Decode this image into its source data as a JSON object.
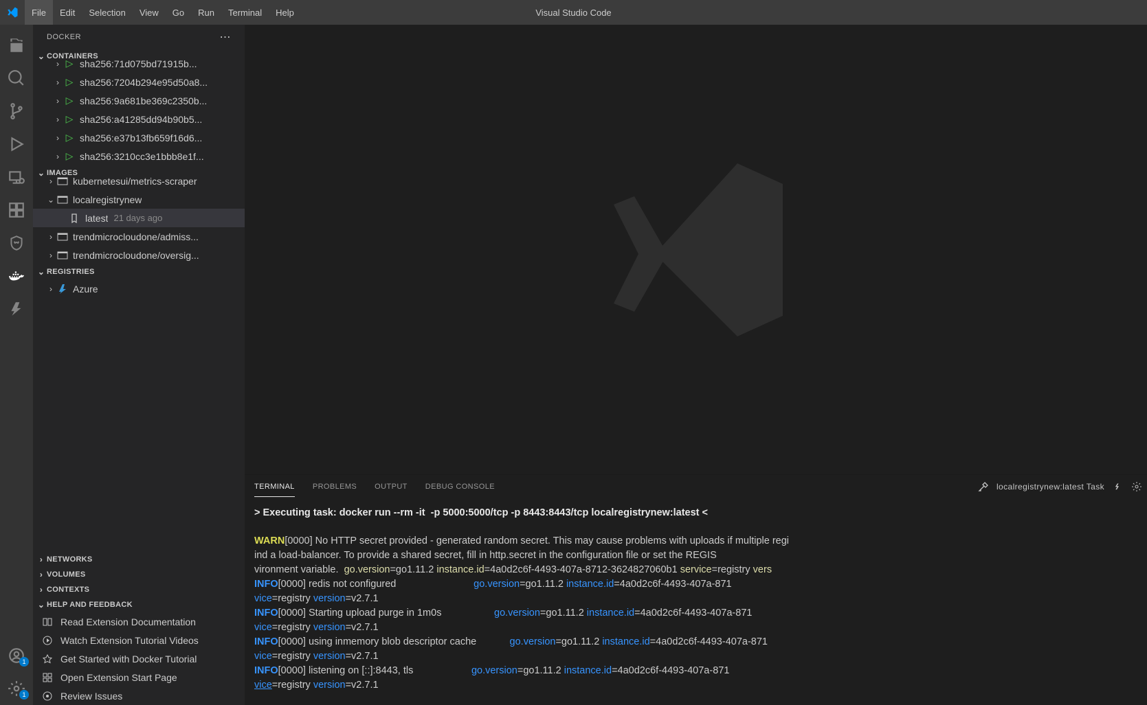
{
  "titlebar": {
    "menus": [
      "File",
      "Edit",
      "Selection",
      "View",
      "Go",
      "Run",
      "Terminal",
      "Help"
    ],
    "title": "Visual Studio Code"
  },
  "activitybar": {
    "accounts_badge": "1",
    "settings_badge": "1"
  },
  "sidebar": {
    "title": "DOCKER",
    "sections": {
      "containers": {
        "label": "CONTAINERS",
        "items": [
          {
            "name": "sha256:71d075bd71915b...",
            "cut": true
          },
          {
            "name": "sha256:7204b294e95d50a8..."
          },
          {
            "name": "sha256:9a681be369c2350b..."
          },
          {
            "name": "sha256:a41285dd94b90b5..."
          },
          {
            "name": "sha256:e37b13fb659f16d6..."
          },
          {
            "name": "sha256:3210cc3e1bbb8e1f..."
          }
        ]
      },
      "images": {
        "label": "IMAGES",
        "items": [
          {
            "name": "kubernetesui/metrics-scraper",
            "expanded": false
          },
          {
            "name": "localregistrynew",
            "expanded": true,
            "tags": [
              {
                "tag": "latest",
                "age": "21 days ago"
              }
            ]
          },
          {
            "name": "trendmicrocloudone/admiss...",
            "expanded": false
          },
          {
            "name": "trendmicrocloudone/oversig...",
            "expanded": false
          }
        ]
      },
      "registries": {
        "label": "REGISTRIES",
        "items": [
          {
            "name": "Azure"
          }
        ]
      },
      "networks": {
        "label": "NETWORKS"
      },
      "volumes": {
        "label": "VOLUMES"
      },
      "contexts": {
        "label": "CONTEXTS"
      },
      "help": {
        "label": "HELP AND FEEDBACK",
        "items": [
          "Read Extension Documentation",
          "Watch Extension Tutorial Videos",
          "Get Started with Docker Tutorial",
          "Open Extension Start Page",
          "Review Issues"
        ]
      }
    }
  },
  "panel": {
    "tabs": [
      "TERMINAL",
      "PROBLEMS",
      "OUTPUT",
      "DEBUG CONSOLE"
    ],
    "active_tab": "TERMINAL",
    "task_label": "localregistrynew:latest Task",
    "exec_line": "> Executing task: docker run --rm -it  -p 5000:5000/tcp -p 8443:8443/tcp localregistrynew:latest <",
    "lines": {
      "warn_tag": "WARN",
      "warn_ts": "[0000]",
      "warn_l1": " No HTTP secret provided - generated random secret. This may cause problems with uploads if multiple regi",
      "warn_l2": "ind a load-balancer. To provide a shared secret, fill in http.secret in the configuration file or set the REGIS",
      "warn_l3a": "vironment variable.  ",
      "gv": "go.version",
      "gv_v": "=go1.11.2 ",
      "iid": "instance.id",
      "iid_v": "=4a0d2c6f-4493-407a-8712-3624827060b1 ",
      "svc": "service",
      "svc_v": "=registry ",
      "vers": "vers",
      "info_tag": "INFO",
      "info_ts": "[0000]",
      "info1": " redis not configured",
      "pad1": "                            ",
      "iid_short": "=4a0d2c6f-4493-407a-871",
      "vice": "vice",
      "vice_v": "=registry ",
      "version": "version",
      "version_v": "=v2.7.1",
      "info2": " Starting upload purge in 1m0s",
      "pad2": "                   ",
      "info3": " using inmemory blob descriptor cache",
      "pad3": "            ",
      "info4": " listening on [::]:8443, tls",
      "pad4": "                     "
    }
  }
}
